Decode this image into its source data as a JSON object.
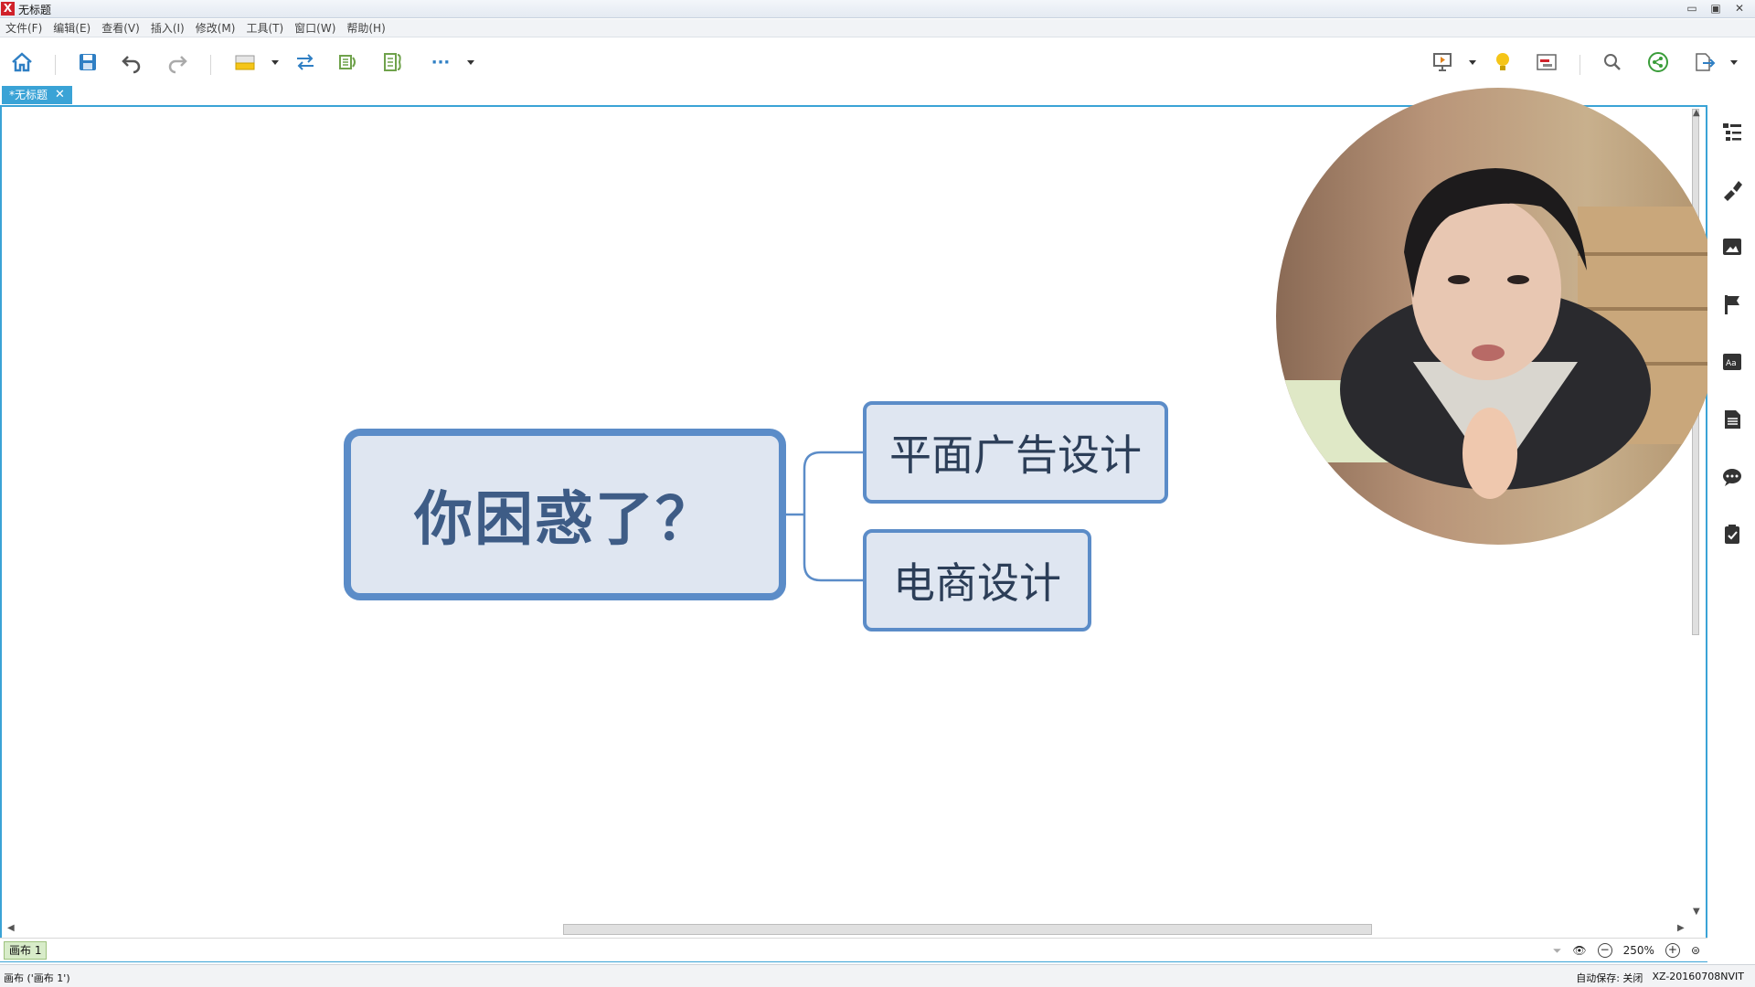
{
  "window": {
    "title": "无标题",
    "logo": "X",
    "buttons": [
      "▭",
      "▣",
      "✕"
    ]
  },
  "menu": [
    "文件(F)",
    "编辑(E)",
    "查看(V)",
    "插入(I)",
    "修改(M)",
    "工具(T)",
    "窗口(W)",
    "帮助(H)"
  ],
  "toolbar": {
    "icons": [
      "home-icon",
      "save-icon",
      "undo-icon",
      "redo-icon",
      "topic-style-icon",
      "relationship-icon",
      "summary-icon",
      "boundary-icon",
      "more-icon"
    ],
    "right_icons": [
      "presentation-icon",
      "idea-icon",
      "gantt-icon",
      "search-icon",
      "share-icon",
      "export-icon"
    ],
    "more_label": "···"
  },
  "tab": {
    "label": "*无标题",
    "close": "✕"
  },
  "mindmap": {
    "central_topic": "你困惑了？",
    "subtopics": [
      "平面广告设计",
      "电商设计"
    ],
    "colors": {
      "fill": "#dfe6f1",
      "border": "#5b8cc8",
      "central_text": "#3e5c86",
      "line": "#5b8cc8"
    }
  },
  "sidebar": {
    "icons": [
      "outline-icon",
      "format-icon",
      "image-icon",
      "marker-icon",
      "text-style-icon",
      "notes-icon",
      "comments-icon",
      "task-icon"
    ]
  },
  "sheetbar": {
    "sheet_tab": "画布 1",
    "zoom": "250%",
    "zoom_out": "−",
    "zoom_in": "+"
  },
  "status": {
    "left": "画布 ('画布 1')",
    "autosave": "自动保存: 关闭",
    "machine": "XZ-20160708NVIT"
  },
  "accent_color": "#3aa3d6"
}
